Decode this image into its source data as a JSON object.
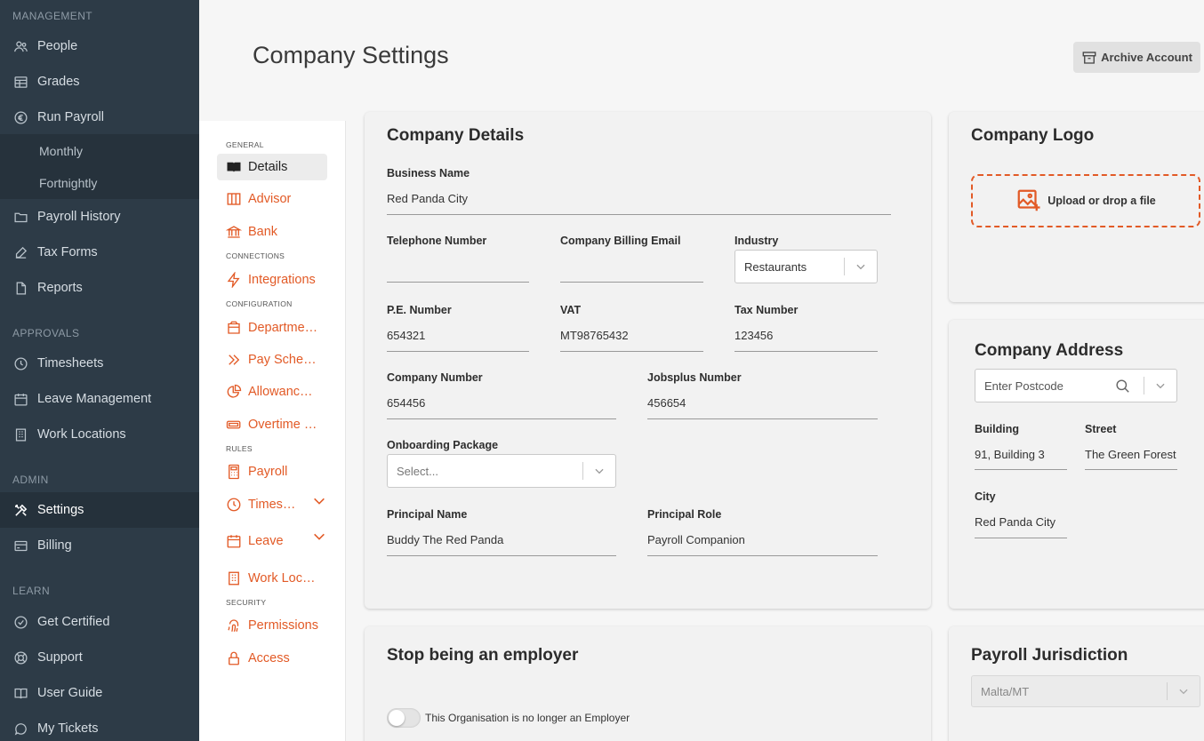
{
  "colors": {
    "accent": "#e25a26",
    "sidebar_bg": "#2d3b47"
  },
  "sidebar": {
    "management_header": "MANAGEMENT",
    "people": "People",
    "grades": "Grades",
    "run_payroll": "Run Payroll",
    "monthly": "Monthly",
    "fortnightly": "Fortnightly",
    "payroll_history": "Payroll History",
    "tax_forms": "Tax Forms",
    "reports": "Reports",
    "approvals_header": "APPROVALS",
    "timesheets": "Timesheets",
    "leave_management": "Leave Management",
    "work_locations": "Work Locations",
    "admin_header": "ADMIN",
    "settings": "Settings",
    "billing": "Billing",
    "learn_header": "LEARN",
    "get_certified": "Get Certified",
    "support": "Support",
    "user_guide": "User Guide",
    "my_tickets": "My Tickets"
  },
  "header": {
    "title": "Company Settings",
    "archive_label": "Archive Account"
  },
  "subnav": {
    "general": "GENERAL",
    "details": "Details",
    "advisor": "Advisor",
    "bank": "Bank",
    "connections": "CONNECTIONS",
    "integrations": "Integrations",
    "configuration": "CONFIGURATION",
    "departments": "Departme…",
    "pay_schedules": "Pay Sched…",
    "allowances": "Allowance…",
    "overtime": "Overtime …",
    "rules": "RULES",
    "payroll": "Payroll",
    "timesheets": "Times…",
    "leave": "Leave",
    "work_locations": "Work Loca…",
    "security": "SECURITY",
    "permissions": "Permissions",
    "access": "Access"
  },
  "company_details": {
    "title": "Company Details",
    "business_name_label": "Business Name",
    "business_name": "Red Panda City",
    "telephone_label": "Telephone Number",
    "telephone": "",
    "billing_email_label": "Company Billing Email",
    "billing_email": "",
    "industry_label": "Industry",
    "industry": "Restaurants",
    "pe_label": "P.E. Number",
    "pe": "654321",
    "vat_label": "VAT",
    "vat": "MT98765432",
    "tax_label": "Tax Number",
    "tax": "123456",
    "company_number_label": "Company Number",
    "company_number": "654456",
    "jobsplus_label": "Jobsplus Number",
    "jobsplus": "456654",
    "onboarding_label": "Onboarding Package",
    "onboarding_placeholder": "Select...",
    "principal_name_label": "Principal Name",
    "principal_name": "Buddy The Red Panda",
    "principal_role_label": "Principal Role",
    "principal_role": "Payroll Companion"
  },
  "company_logo": {
    "title": "Company Logo",
    "upload_label": "Upload or drop a file"
  },
  "company_address": {
    "title": "Company Address",
    "postcode_placeholder": "Enter Postcode",
    "building_label": "Building",
    "building": "91, Building 3",
    "street_label": "Street",
    "street": "The Green Forest",
    "city_label": "City",
    "city": "Red Panda City"
  },
  "stop_employer": {
    "title": "Stop being an employer",
    "toggle_label": "This Organisation is no longer an Employer"
  },
  "payroll_jurisdiction": {
    "title": "Payroll Jurisdiction",
    "value": "Malta/MT"
  }
}
